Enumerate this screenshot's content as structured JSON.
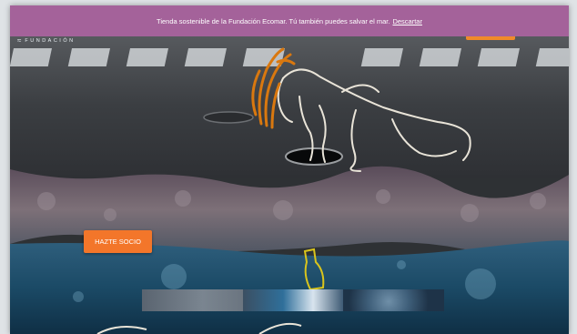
{
  "promo_bar": {
    "text": "Tienda sostenible de la Fundación Ecomar. Tú también puedes salvar el mar.",
    "dismiss_label": "Descartar"
  },
  "header": {
    "logo_text": "FUNDACIÓN"
  },
  "hero": {
    "cta_label": "HAZTE SOCIO"
  },
  "colors": {
    "promo_bg": "#a4629a",
    "cta_bg": "#f3762a",
    "accent_orange": "#f08a2a"
  },
  "icons": [
    "hamburger-menu-icon",
    "wave-logo-icon"
  ]
}
